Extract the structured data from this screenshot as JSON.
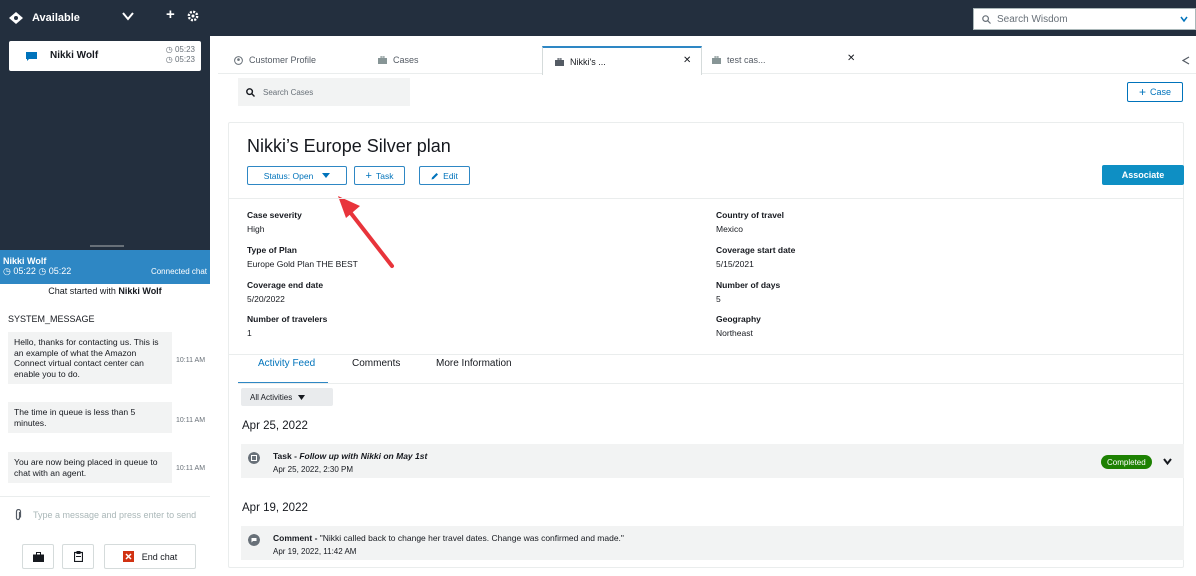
{
  "topbar": {
    "status": "Available",
    "plus": "+",
    "wisdom_placeholder": "Search Wisdom"
  },
  "contact_card": {
    "name": "Nikki Wolf",
    "time1": "◷ 05:23",
    "time2": "◷ 05:23"
  },
  "chat": {
    "banner_name": "Nikki Wolf",
    "banner_times": "◷ 05:22  ◷ 05:22",
    "banner_status": "Connected chat",
    "started_prefix": "Chat started with",
    "started_name": "Nikki Wolf",
    "sender": "SYSTEM_MESSAGE",
    "messages": [
      {
        "text": "Hello, thanks for contacting us. This is an example of what the Amazon Connect virtual contact center can enable you to do.",
        "time": "10:11 AM"
      },
      {
        "text": "The time in queue is less than 5 minutes.",
        "time": "10:11 AM"
      },
      {
        "text": "You are now being placed in queue to chat with an agent.",
        "time": "10:11 AM"
      }
    ],
    "composer_placeholder": "Type a message and press enter to send",
    "end_chat": "End chat"
  },
  "tabs": [
    {
      "label": "Customer Profile"
    },
    {
      "label": "Cases"
    },
    {
      "label": "Nikki's ..."
    },
    {
      "label": "test cas..."
    }
  ],
  "search_cases_placeholder": "Search Cases",
  "case_button": "Case",
  "case": {
    "title": "Nikki’s Europe Silver plan",
    "status_label": "Status: Open",
    "task_label": "Task",
    "edit_label": "Edit",
    "associate_label": "Associate",
    "fields_left": [
      {
        "label": "Case severity",
        "value": "High"
      },
      {
        "label": "Type of Plan",
        "value": "Europe Gold Plan THE BEST"
      },
      {
        "label": "Coverage end date",
        "value": "5/20/2022"
      },
      {
        "label": "Number of travelers",
        "value": "1"
      }
    ],
    "fields_right": [
      {
        "label": "Country of travel",
        "value": "Mexico"
      },
      {
        "label": "Coverage start date",
        "value": "5/15/2021"
      },
      {
        "label": "Number of days",
        "value": "5"
      },
      {
        "label": "Geography",
        "value": "Northeast"
      }
    ]
  },
  "subtabs": [
    "Activity Feed",
    "Comments",
    "More Information"
  ],
  "filter_label": "All Activities",
  "activities": [
    {
      "date_header": "Apr 25, 2022",
      "type": "Task",
      "title": "Follow up with Nikki on May 1st",
      "datetime": "Apr 25, 2022, 2:30 PM",
      "status": "Completed"
    },
    {
      "date_header": "Apr 19, 2022",
      "type": "Comment",
      "title": "\"Nikki called back to change her travel dates. Change was confirmed and made.\"",
      "datetime": "Apr 19, 2022, 11:42 AM"
    }
  ],
  "colors": {
    "topbar": "#232f3e",
    "accent": "#0073bb",
    "chat_banner": "#2e87c4",
    "associate": "#0e8fc4",
    "completed": "#1d8102",
    "annotation_arrow": "#e8343b"
  }
}
